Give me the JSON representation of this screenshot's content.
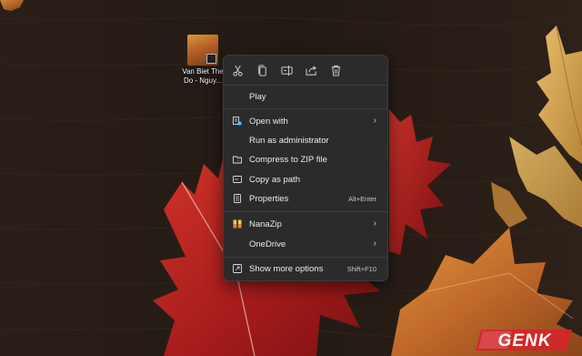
{
  "desktop": {
    "icon_label": "Van Biet The Do - Nguy..."
  },
  "menu": {
    "toolbar": [
      {
        "name": "cut-icon"
      },
      {
        "name": "copy-icon"
      },
      {
        "name": "rename-icon"
      },
      {
        "name": "share-icon"
      },
      {
        "name": "delete-icon"
      }
    ],
    "items": [
      {
        "label": "Play",
        "shortcut": "",
        "submenu": false
      },
      {
        "label": "Open with",
        "shortcut": "",
        "submenu": true
      },
      {
        "label": "Run as administrator",
        "shortcut": "",
        "submenu": false
      },
      {
        "label": "Compress to ZIP file",
        "shortcut": "",
        "submenu": false
      },
      {
        "label": "Copy as path",
        "shortcut": "",
        "submenu": false
      },
      {
        "label": "Properties",
        "shortcut": "Alt+Enter",
        "submenu": false
      },
      {
        "label": "NanaZip",
        "shortcut": "",
        "submenu": true
      },
      {
        "label": "OneDrive",
        "shortcut": "",
        "submenu": true
      },
      {
        "label": "Show more options",
        "shortcut": "Shift+F10",
        "submenu": false
      }
    ],
    "chevron": "›"
  },
  "watermark": {
    "text": "GENK"
  },
  "colors": {
    "menu_bg": "#2b2b2b",
    "accent": "#4cc2ff",
    "leaf_red": "#b01e1e",
    "leaf_orange": "#c77428",
    "wood": "#2a1f18"
  }
}
